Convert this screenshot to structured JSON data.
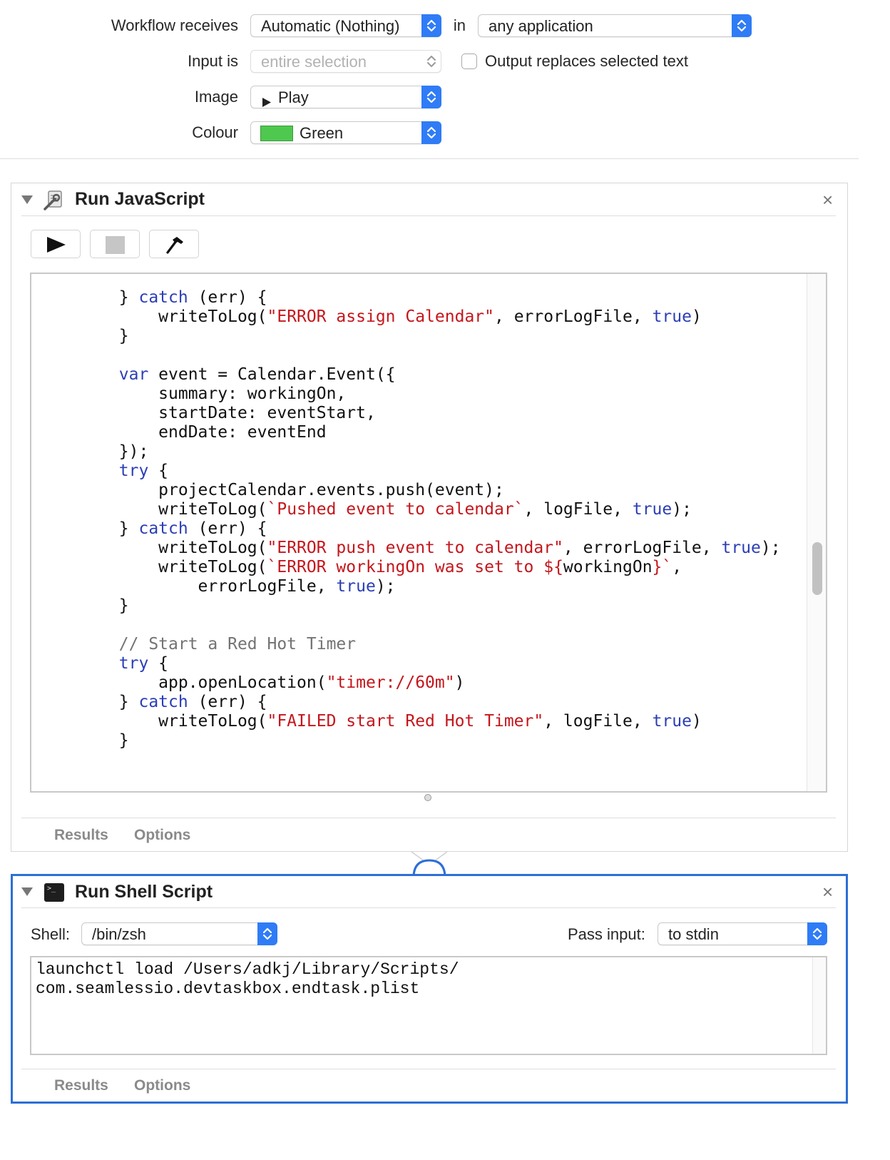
{
  "workflow": {
    "receives_label": "Workflow receives",
    "receives_value": "Automatic (Nothing)",
    "in_label": "in",
    "application_value": "any application",
    "input_is_label": "Input is",
    "input_is_value": "entire selection",
    "output_replaces_label": "Output replaces selected text",
    "output_replaces_checked": false,
    "image_label": "Image",
    "image_value": "Play",
    "image_icon": "play-triangle-icon",
    "colour_label": "Colour",
    "colour_value": "Green",
    "colour_swatch": "#4fc84f",
    "accent": "#2f7cf6"
  },
  "run_javascript": {
    "title": "Run JavaScript",
    "icon": "script-wrench-icon",
    "toolbar": [
      "run-button",
      "stop-button",
      "compile-hammer-button"
    ],
    "code_lines": [
      [
        [
          "        } ",
          ""
        ],
        [
          "catch",
          "kw"
        ],
        [
          " (err) {",
          ""
        ]
      ],
      [
        [
          "            writeToLog(",
          ""
        ],
        [
          "\"ERROR assign Calendar\"",
          "str"
        ],
        [
          ", errorLogFile, ",
          ""
        ],
        [
          "true",
          "kw"
        ],
        [
          ")",
          ""
        ]
      ],
      [
        [
          "        }",
          ""
        ]
      ],
      [
        [
          "",
          ""
        ]
      ],
      [
        [
          "        ",
          ""
        ],
        [
          "var",
          "kw"
        ],
        [
          " event = Calendar.Event({",
          ""
        ]
      ],
      [
        [
          "            summary: workingOn,",
          ""
        ]
      ],
      [
        [
          "            startDate: eventStart,",
          ""
        ]
      ],
      [
        [
          "            endDate: eventEnd",
          ""
        ]
      ],
      [
        [
          "        });",
          ""
        ]
      ],
      [
        [
          "        ",
          ""
        ],
        [
          "try",
          "kw"
        ],
        [
          " {",
          ""
        ]
      ],
      [
        [
          "            projectCalendar.events.push(event);",
          ""
        ]
      ],
      [
        [
          "            writeToLog(",
          ""
        ],
        [
          "`Pushed event to calendar`",
          "str"
        ],
        [
          ", logFile, ",
          ""
        ],
        [
          "true",
          "kw"
        ],
        [
          ");",
          ""
        ]
      ],
      [
        [
          "        } ",
          ""
        ],
        [
          "catch",
          "kw"
        ],
        [
          " (err) {",
          ""
        ]
      ],
      [
        [
          "            writeToLog(",
          ""
        ],
        [
          "\"ERROR push event to calendar\"",
          "str"
        ],
        [
          ", errorLogFile, ",
          ""
        ],
        [
          "true",
          "kw"
        ],
        [
          ");",
          ""
        ]
      ],
      [
        [
          "            writeToLog(",
          ""
        ],
        [
          "`ERROR workingOn was set to ${",
          "str"
        ],
        [
          "workingOn",
          ""
        ],
        [
          "}`",
          "str"
        ],
        [
          ",",
          ""
        ]
      ],
      [
        [
          "                errorLogFile, ",
          ""
        ],
        [
          "true",
          "kw"
        ],
        [
          ");",
          ""
        ]
      ],
      [
        [
          "        }",
          ""
        ]
      ],
      [
        [
          "",
          ""
        ]
      ],
      [
        [
          "        ",
          ""
        ],
        [
          "// Start a Red Hot Timer",
          "cm"
        ]
      ],
      [
        [
          "        ",
          ""
        ],
        [
          "try",
          "kw"
        ],
        [
          " {",
          ""
        ]
      ],
      [
        [
          "            app.openLocation(",
          ""
        ],
        [
          "\"timer://60m\"",
          "str"
        ],
        [
          ")",
          ""
        ]
      ],
      [
        [
          "        } ",
          ""
        ],
        [
          "catch",
          "kw"
        ],
        [
          " (err) {",
          ""
        ]
      ],
      [
        [
          "            writeToLog(",
          ""
        ],
        [
          "\"FAILED start Red Hot Timer\"",
          "str"
        ],
        [
          ", logFile, ",
          ""
        ],
        [
          "true",
          "kw"
        ],
        [
          ")",
          ""
        ]
      ],
      [
        [
          "        }",
          ""
        ]
      ]
    ],
    "tabs": {
      "results": "Results",
      "options": "Options"
    }
  },
  "run_shell_script": {
    "title": "Run Shell Script",
    "icon": "terminal-icon",
    "shell_label": "Shell:",
    "shell_value": "/bin/zsh",
    "pass_input_label": "Pass input:",
    "pass_input_value": "to stdin",
    "code_lines": [
      "launchctl load /Users/adkj/Library/Scripts/",
      "com.seamlessio.devtaskbox.endtask.plist"
    ],
    "tabs": {
      "results": "Results",
      "options": "Options"
    },
    "selection_color": "#2c6fd6"
  }
}
